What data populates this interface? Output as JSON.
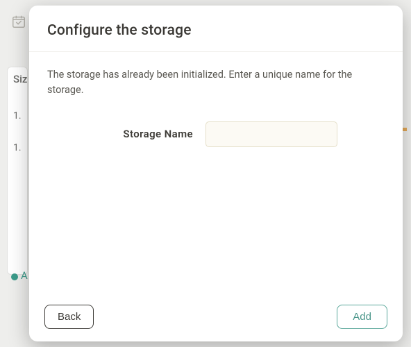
{
  "background": {
    "sidebar_label": "Siz",
    "row1": "1.",
    "row2": "1.",
    "accent_letter": "A"
  },
  "modal": {
    "title": "Configure the storage",
    "description": "The storage has already been initialized. Enter a unique name for the storage.",
    "field": {
      "label": "Storage Name",
      "value": "",
      "placeholder": ""
    },
    "buttons": {
      "back": "Back",
      "add": "Add"
    }
  }
}
